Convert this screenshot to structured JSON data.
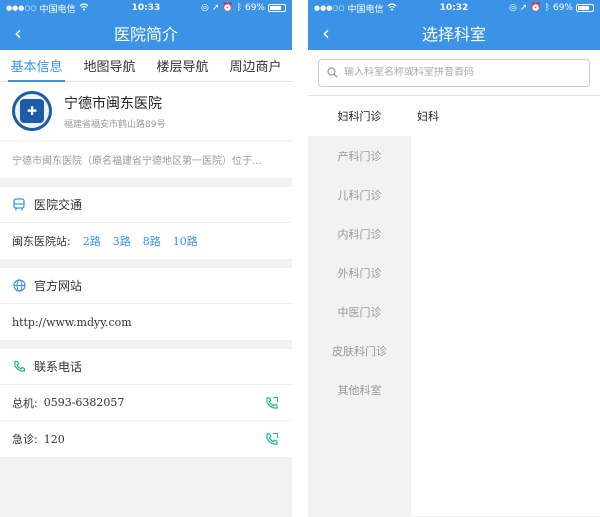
{
  "status": {
    "left": {
      "carrier": "中国电信"
    },
    "screen1_time": "10:33",
    "screen2_time": "10:32",
    "battery": "69%"
  },
  "screen1": {
    "nav_title": "医院简介",
    "tabs": [
      {
        "label": "基本信息",
        "active": true
      },
      {
        "label": "地图导航",
        "active": false
      },
      {
        "label": "楼层导航",
        "active": false
      },
      {
        "label": "周边商户",
        "active": false
      }
    ],
    "hospital": {
      "name": "宁德市闽东医院",
      "address": "福建省福安市鹤山路89号",
      "description": "宁德市闽东医院（原名福建省宁德地区第一医院）位于..."
    },
    "transport": {
      "title": "医院交通",
      "station": "闽东医院站:",
      "routes": [
        "2路",
        "3路",
        "8路",
        "10路"
      ]
    },
    "website": {
      "title": "官方网站",
      "url": "http://www.mdyy.com"
    },
    "contact": {
      "title": "联系电话",
      "rows": [
        {
          "label": "总机:",
          "number": "0593-6382057"
        },
        {
          "label": "急诊:",
          "number": "120"
        }
      ]
    }
  },
  "screen2": {
    "nav_title": "选择科室",
    "search_placeholder": "输入科室名称或科室拼音首码",
    "departments": [
      {
        "label": "妇科门诊",
        "active": true
      },
      {
        "label": "产科门诊",
        "active": false
      },
      {
        "label": "儿科门诊",
        "active": false
      },
      {
        "label": "内科门诊",
        "active": false
      },
      {
        "label": "外科门诊",
        "active": false
      },
      {
        "label": "中医门诊",
        "active": false
      },
      {
        "label": "皮肤科门诊",
        "active": false
      },
      {
        "label": "其他科室",
        "active": false
      }
    ],
    "sub_departments": [
      "妇科"
    ]
  },
  "colors": {
    "primary": "#3a93e6",
    "transport_icon": "#3a93e6",
    "web_icon": "#3a93e6",
    "phone_icon": "#2eb39a"
  },
  "icons": {
    "back": "chevron-left-icon",
    "transport": "bus-icon",
    "website": "globe-icon",
    "phone": "phone-icon",
    "search": "search-icon"
  }
}
